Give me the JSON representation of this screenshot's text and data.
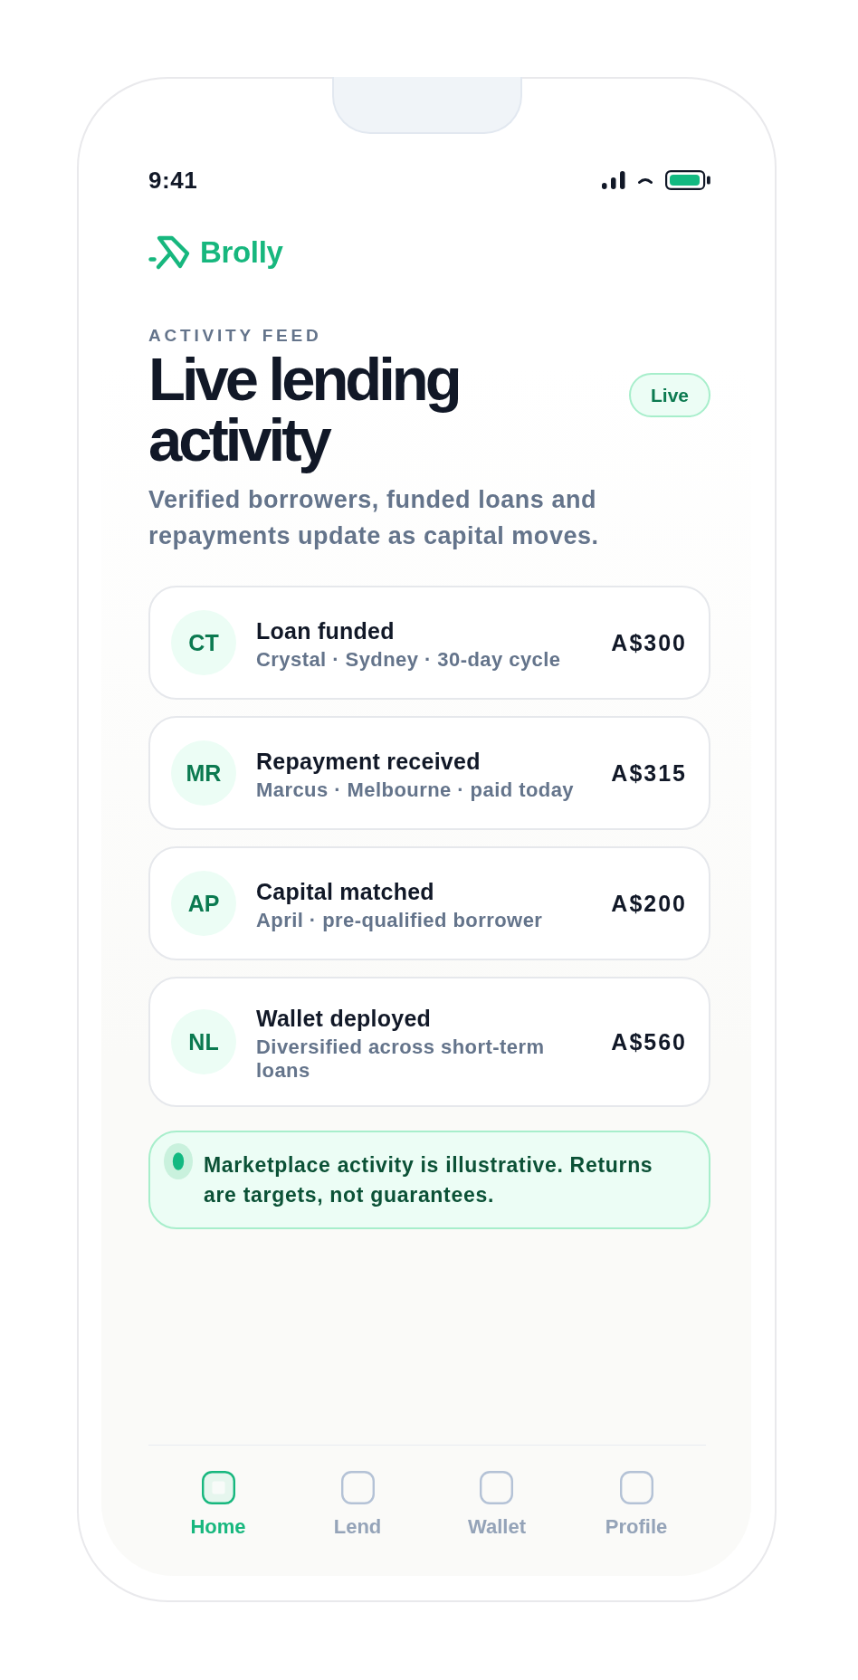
{
  "status_bar": {
    "time": "9:41"
  },
  "brand": {
    "name": "Brolly"
  },
  "header": {
    "eyebrow": "ACTIVITY FEED",
    "title": "Live lending activity",
    "badge": "Live",
    "subtitle": "Verified borrowers, funded loans and repayments update as capital moves."
  },
  "activities": [
    {
      "initials": "CT",
      "title": "Loan funded",
      "meta": "Crystal · Sydney · 30-day cycle",
      "amount": "A$300"
    },
    {
      "initials": "MR",
      "title": "Repayment received",
      "meta": "Marcus · Melbourne · paid today",
      "amount": "A$315"
    },
    {
      "initials": "AP",
      "title": "Capital matched",
      "meta": "April · pre-qualified borrower",
      "amount": "A$200"
    },
    {
      "initials": "NL",
      "title": "Wallet deployed",
      "meta": "Diversified across short-term loans",
      "amount": "A$560"
    }
  ],
  "notice": {
    "text": "Marketplace activity is illustrative. Returns are targets, not guarantees."
  },
  "tabs": [
    {
      "label": "Home",
      "selected": true
    },
    {
      "label": "Lend",
      "selected": false
    },
    {
      "label": "Wallet",
      "selected": false
    },
    {
      "label": "Profile",
      "selected": false
    }
  ]
}
